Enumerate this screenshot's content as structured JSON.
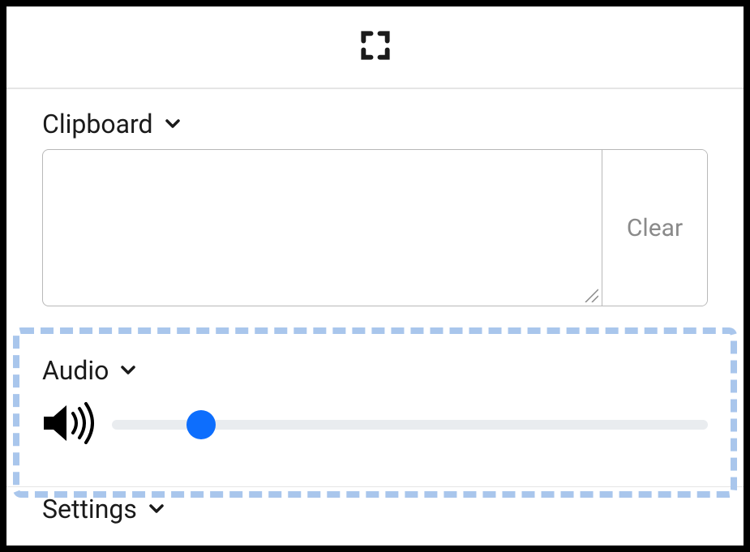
{
  "sections": {
    "clipboard": {
      "title": "Clipboard",
      "textarea_value": "",
      "clear_label": "Clear"
    },
    "audio": {
      "title": "Audio",
      "volume_percent": 15
    },
    "settings": {
      "title": "Settings"
    }
  },
  "icons": {
    "fullscreen": "fullscreen-icon",
    "chevron_down": "chevron-down-icon",
    "volume_high": "volume-high-icon"
  },
  "highlight": {
    "target": "audio-section"
  }
}
